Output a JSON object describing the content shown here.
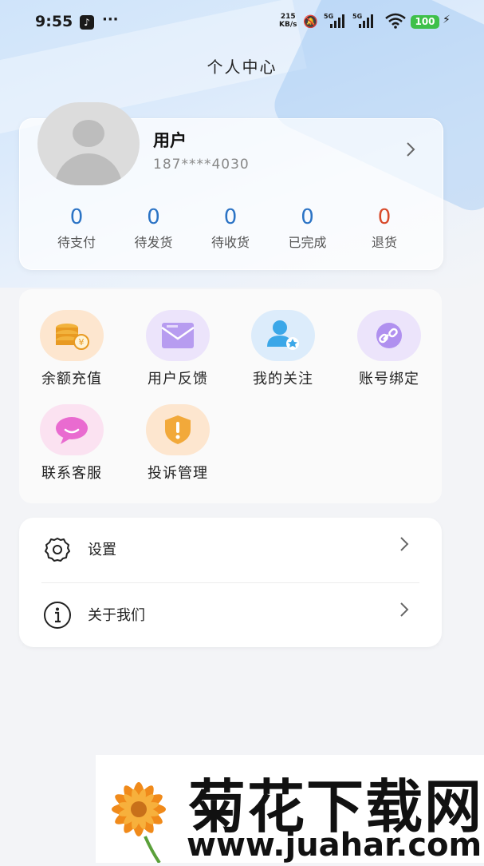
{
  "status_bar": {
    "time": "9:55",
    "net_speed_value": "215",
    "net_speed_unit": "KB/s",
    "signal_label_1": "5G",
    "signal_label_2": "5G",
    "battery": "100"
  },
  "header": {
    "title": "个人中心"
  },
  "profile": {
    "name": "用户",
    "phone": "187****4030"
  },
  "orders": [
    {
      "count": "0",
      "label": "待支付"
    },
    {
      "count": "0",
      "label": "待发货"
    },
    {
      "count": "0",
      "label": "待收货"
    },
    {
      "count": "0",
      "label": "已完成"
    },
    {
      "count": "0",
      "label": "退货"
    }
  ],
  "tools": [
    {
      "label": "余额充值",
      "icon": "coins-icon",
      "color": "#f0a23a"
    },
    {
      "label": "用户反馈",
      "icon": "mail-icon",
      "color": "#9c7be8"
    },
    {
      "label": "我的关注",
      "icon": "user-star-icon",
      "color": "#3aa6e8"
    },
    {
      "label": "账号绑定",
      "icon": "link-icon",
      "color": "#a67be8"
    },
    {
      "label": "联系客服",
      "icon": "chat-bubble-icon",
      "color": "#e86bc8"
    },
    {
      "label": "投诉管理",
      "icon": "shield-alert-icon",
      "color": "#f0a23a"
    }
  ],
  "settings": [
    {
      "label": "设置",
      "icon": "gear-icon"
    },
    {
      "label": "关于我们",
      "icon": "info-icon"
    }
  ],
  "watermark": {
    "title": "菊花下载网",
    "url": "www.juahar.com"
  }
}
